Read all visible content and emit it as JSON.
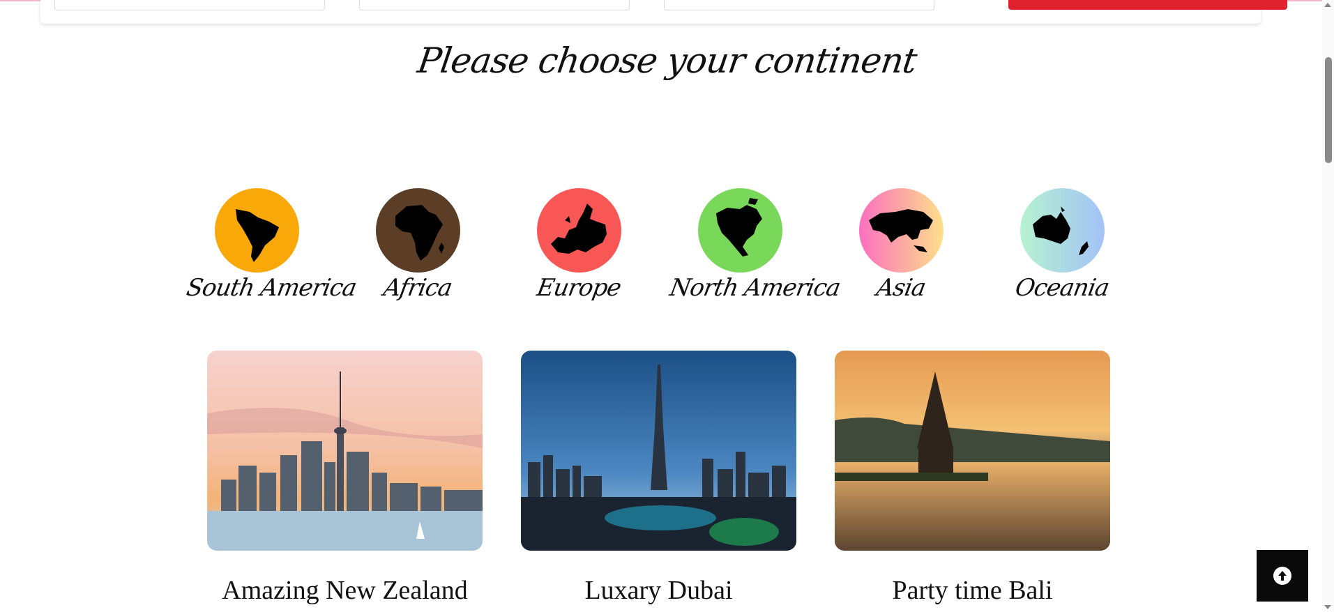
{
  "heading": "Please choose your continent",
  "continents": [
    {
      "label": "South America",
      "icon": "south-america-map-icon",
      "color": "#f9a80a"
    },
    {
      "label": "Africa",
      "icon": "africa-map-icon",
      "color": "#5c3d26"
    },
    {
      "label": "Europe",
      "icon": "europe-map-icon",
      "color": "#f95656"
    },
    {
      "label": "North America",
      "icon": "north-america-map-icon",
      "color": "#79d85a"
    },
    {
      "label": "Asia",
      "icon": "asia-map-icon",
      "color": "gradient-pink-yellow"
    },
    {
      "label": "Oceania",
      "icon": "oceania-map-icon",
      "color": "gradient-mint-blue"
    }
  ],
  "destinations": [
    {
      "title": "Amazing New Zealand"
    },
    {
      "title": "Luxary Dubai"
    },
    {
      "title": "Party time Bali"
    }
  ],
  "colors": {
    "accent": "#e0222f",
    "back_to_top": "#0a0a0a"
  }
}
